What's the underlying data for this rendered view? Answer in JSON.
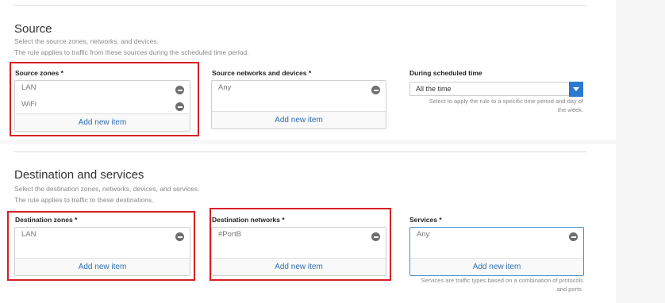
{
  "source": {
    "title": "Source",
    "desc1": "Select the source zones, networks, and devices.",
    "desc2": "The rule applies to traffic from these sources during the scheduled time period.",
    "zones": {
      "label": "Source zones *",
      "items": [
        "LAN",
        "WiFi"
      ],
      "add_label": "Add new item"
    },
    "networks": {
      "label": "Source networks and devices *",
      "items": [
        "Any"
      ],
      "add_label": "Add new item"
    },
    "schedule": {
      "label": "During scheduled time",
      "value": "All the time",
      "hint": "Select to apply the rule to a specific time period and day of the week."
    }
  },
  "destination": {
    "title": "Destination and services",
    "desc1": "Select the destination zones, networks, devices, and services.",
    "desc2": "The rule applies to traffic to these destinations.",
    "zones": {
      "label": "Destination zones *",
      "items": [
        "LAN"
      ],
      "add_label": "Add new item"
    },
    "networks": {
      "label": "Destination networks *",
      "items": [
        "#PortB"
      ],
      "add_label": "Add new item"
    },
    "services": {
      "label": "Services *",
      "items": [
        "Any"
      ],
      "add_label": "Add new item",
      "hint": "Services are traffic types based on a combination of protocols and ports."
    }
  },
  "colors": {
    "highlight": "#d61f26",
    "link": "#2f6fb0",
    "accent": "#2a7ad2"
  },
  "icons": {
    "remove": "minus-circle-icon",
    "dropdown": "chevron-down-icon"
  }
}
